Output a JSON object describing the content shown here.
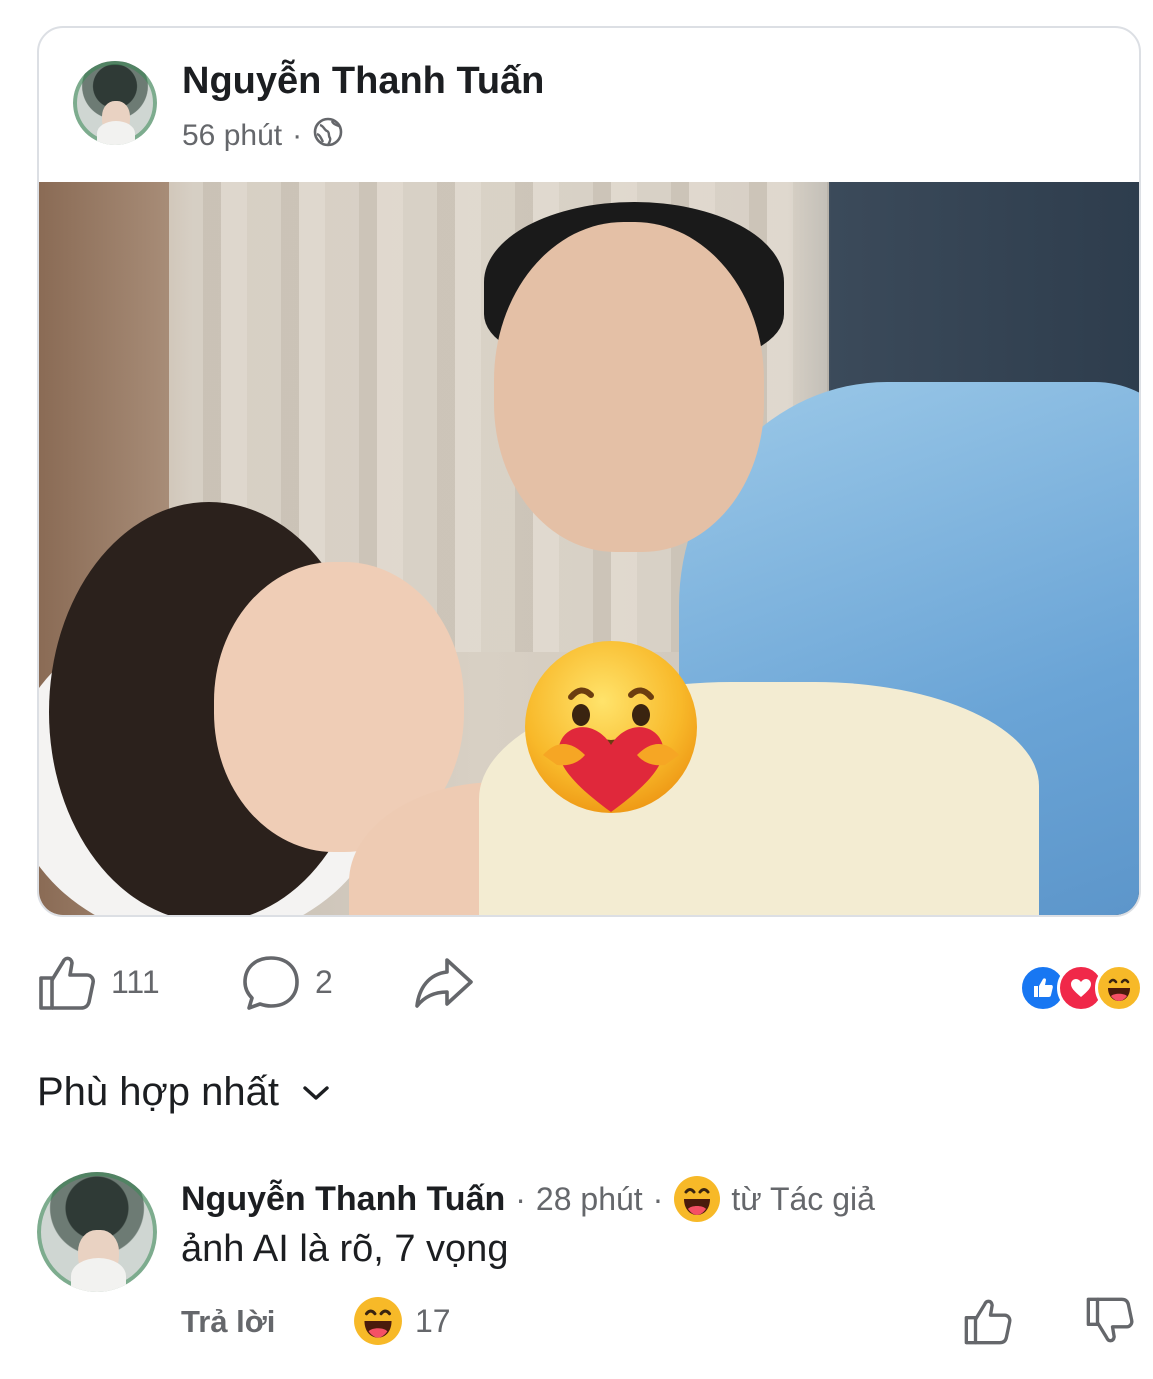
{
  "post": {
    "author": "Nguyễn Thanh Tuấn",
    "time": "56 phút",
    "separator": "·",
    "privacy_icon": "globe-icon",
    "photo_overlay_icon": "care-reaction-emoji"
  },
  "actions": {
    "like_count": "111",
    "comment_count": "2",
    "reaction_icons": [
      "like-reaction-icon",
      "love-reaction-icon",
      "haha-reaction-icon"
    ]
  },
  "comments_sort": {
    "label": "Phù hợp nhất"
  },
  "comment": {
    "author": "Nguyễn Thanh Tuấn",
    "separator": "·",
    "time": "28 phút",
    "badge_label": "từ Tác giả",
    "text": "ảnh AI là rõ, 7 vọng",
    "reply_label": "Trả lời",
    "reaction_count": "17"
  },
  "colors": {
    "primary_text": "#1c1e21",
    "secondary_text": "#65676b",
    "like_blue": "#1877f2",
    "love_red": "#f02849",
    "haha_yellow": "#f7b928"
  }
}
